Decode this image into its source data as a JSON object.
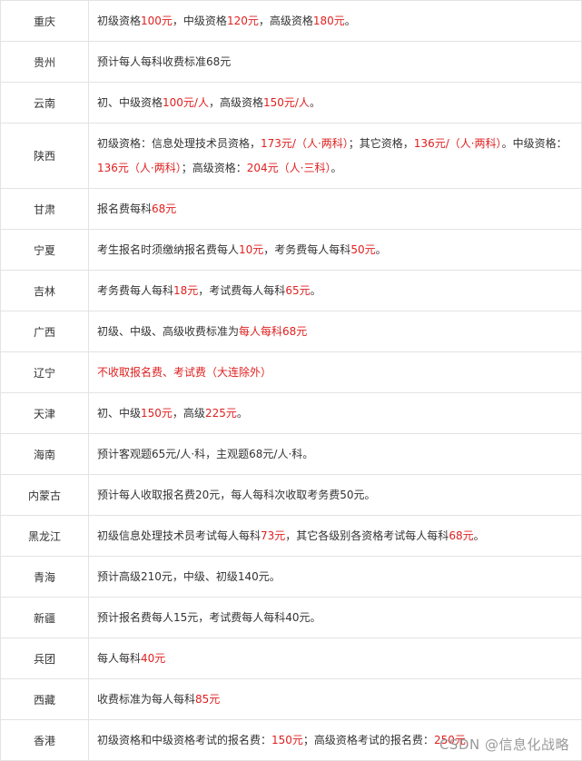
{
  "rows": [
    {
      "province": "重庆",
      "segments": [
        {
          "t": "初级资格"
        },
        {
          "t": "100元",
          "red": true
        },
        {
          "t": "，中级资格"
        },
        {
          "t": "120元",
          "red": true
        },
        {
          "t": "，高级资格"
        },
        {
          "t": "180元",
          "red": true
        },
        {
          "t": "。"
        }
      ]
    },
    {
      "province": "贵州",
      "segments": [
        {
          "t": "预计每人每科收费标准68元"
        }
      ]
    },
    {
      "province": "云南",
      "segments": [
        {
          "t": "初、中级资格"
        },
        {
          "t": "100元/人",
          "red": true
        },
        {
          "t": "，高级资格"
        },
        {
          "t": "150元/人",
          "red": true
        },
        {
          "t": "。"
        }
      ]
    },
    {
      "province": "陕西",
      "segments": [
        {
          "t": "初级资格：信息处理技术员资格，"
        },
        {
          "t": "173元/（人·两科）",
          "red": true
        },
        {
          "t": "；其它资格，"
        },
        {
          "t": "136元/（人·两科）",
          "red": true
        },
        {
          "t": "。中级资格："
        },
        {
          "t": "136元（人·两科）",
          "red": true
        },
        {
          "t": "；高级资格："
        },
        {
          "t": "204元（人·三科）",
          "red": true
        },
        {
          "t": "。"
        }
      ]
    },
    {
      "province": "甘肃",
      "segments": [
        {
          "t": "报名费每科"
        },
        {
          "t": "68元",
          "red": true
        }
      ]
    },
    {
      "province": "宁夏",
      "segments": [
        {
          "t": "考生报名时须缴纳报名费每人"
        },
        {
          "t": "10元",
          "red": true
        },
        {
          "t": "，考务费每人每科"
        },
        {
          "t": "50元",
          "red": true
        },
        {
          "t": "。"
        }
      ]
    },
    {
      "province": "吉林",
      "segments": [
        {
          "t": "考务费每人每科"
        },
        {
          "t": "18元",
          "red": true
        },
        {
          "t": "，考试费每人每科"
        },
        {
          "t": "65元",
          "red": true
        },
        {
          "t": "。"
        }
      ]
    },
    {
      "province": "广西",
      "segments": [
        {
          "t": "初级、中级、高级收费标准为"
        },
        {
          "t": "每人每科68元",
          "red": true
        }
      ]
    },
    {
      "province": "辽宁",
      "segments": [
        {
          "t": "不收取报名费、考试费（大连除外）",
          "red": true
        }
      ]
    },
    {
      "province": "天津",
      "segments": [
        {
          "t": "初、中级"
        },
        {
          "t": "150元",
          "red": true
        },
        {
          "t": "，高级"
        },
        {
          "t": "225元",
          "red": true
        },
        {
          "t": "。"
        }
      ]
    },
    {
      "province": "海南",
      "segments": [
        {
          "t": "预计客观题65元/人·科，主观题68元/人·科。"
        }
      ]
    },
    {
      "province": "内蒙古",
      "segments": [
        {
          "t": "预计每人收取报名费20元，每人每科次收取考务费50元。"
        }
      ]
    },
    {
      "province": "黑龙江",
      "segments": [
        {
          "t": "初级信息处理技术员考试每人每科"
        },
        {
          "t": "73元",
          "red": true
        },
        {
          "t": "，其它各级别各资格考试每人每科"
        },
        {
          "t": "68元",
          "red": true
        },
        {
          "t": "。"
        }
      ]
    },
    {
      "province": "青海",
      "segments": [
        {
          "t": "预计高级210元，中级、初级140元。"
        }
      ]
    },
    {
      "province": "新疆",
      "segments": [
        {
          "t": "预计报名费每人15元，考试费每人每科40元。"
        }
      ]
    },
    {
      "province": "兵团",
      "segments": [
        {
          "t": "每人每科"
        },
        {
          "t": "40元",
          "red": true
        }
      ]
    },
    {
      "province": "西藏",
      "segments": [
        {
          "t": "收费标准为每人每科"
        },
        {
          "t": "85元",
          "red": true
        }
      ]
    },
    {
      "province": "香港",
      "segments": [
        {
          "t": "初级资格和中级资格考试的报名费："
        },
        {
          "t": "150元",
          "red": true
        },
        {
          "t": "；高级资格考试的报名费："
        },
        {
          "t": "250元",
          "red": true
        }
      ]
    }
  ],
  "watermark": "CSDN @信息化战略",
  "colors": {
    "highlight": "#e02020",
    "text": "#333333",
    "border": "#e3e3e3"
  }
}
